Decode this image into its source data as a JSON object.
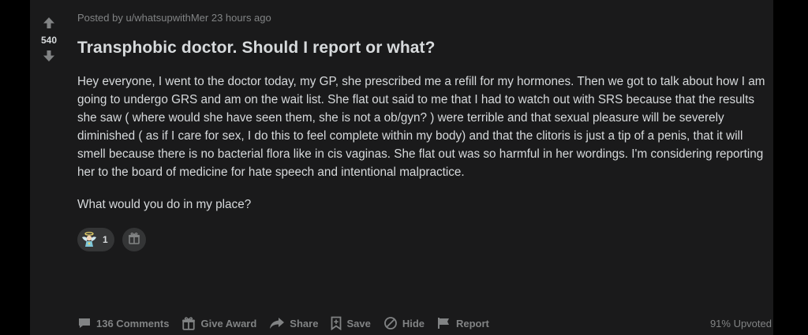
{
  "post": {
    "score": "540",
    "meta": {
      "prefix": "Posted by",
      "author": "u/whatsupwithMer",
      "time": "23 hours ago"
    },
    "title": "Transphobic doctor. Should I report or what?",
    "paragraphs": [
      "Hey everyone, I went to the doctor today, my GP, she prescribed me a refill for my hormones. Then we got to talk about how I am going to undergo GRS and am on the wait list. She flat out said to me that I had to watch out with SRS because that the results she saw ( where would she have seen them, she is not a ob/gyn? ) were terrible and that sexual pleasure will be severely diminished ( as if I care for sex, I do this to feel complete within my body) and that the clitoris is just a tip of a penis, that it will smell because there is no bacterial flora like in cis vaginas. She flat out was so harmful in her wordings. I'm considering reporting her to the board of medicine for hate speech and intentional malpractice.",
      "What would you do in my place?"
    ],
    "awards": {
      "count": "1"
    },
    "actions": {
      "comments": "136 Comments",
      "give_award": "Give Award",
      "share": "Share",
      "save": "Save",
      "hide": "Hide",
      "report": "Report"
    },
    "upvoted": "91% Upvoted"
  },
  "icons": {
    "upvote": "arrow-up-icon",
    "downvote": "arrow-down-icon",
    "award": "angel-award-icon",
    "gift": "gift-icon",
    "comment": "comment-icon",
    "share": "share-icon",
    "save": "bookmark-icon",
    "hide": "hide-icon",
    "report": "flag-icon"
  },
  "colors": {
    "background": "#000000",
    "card": "#1a1a1b",
    "text": "#d7dadc",
    "muted": "#818384",
    "pill": "#343536"
  }
}
